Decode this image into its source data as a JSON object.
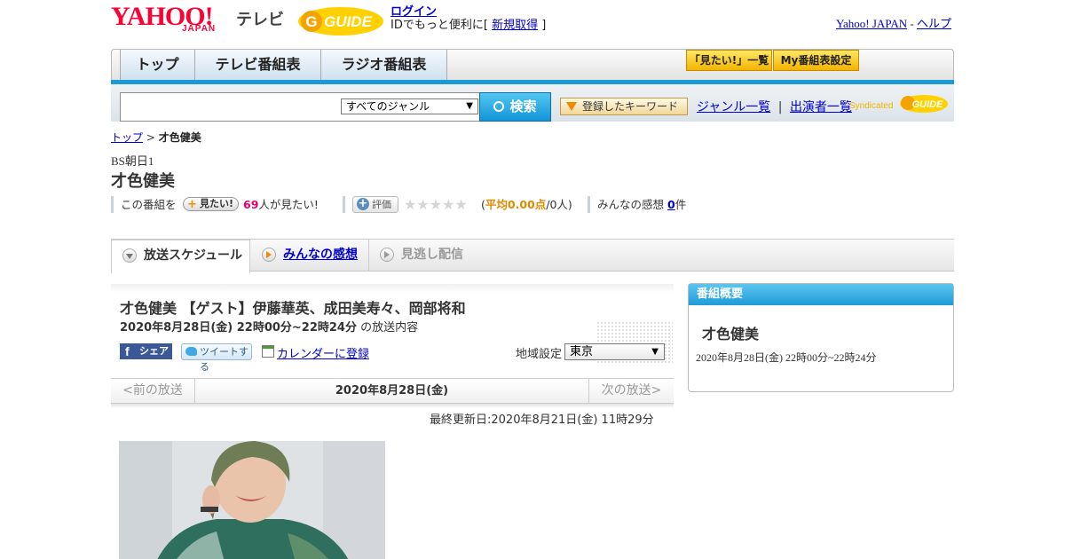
{
  "header": {
    "yahoo_logo": "YAHOO!",
    "japan_logo": "JAPAN",
    "tv_label": "テレビ",
    "gguide_logo": "G-GUIDE",
    "login_label": "ログイン",
    "login_sub_prefix": "IDでもっと便利に[ ",
    "signup_label": "新規取得",
    "login_sub_suffix": " ]",
    "yahoo_japan_link": "Yahoo! JAPAN",
    "separator": " - ",
    "help_link": "ヘルプ"
  },
  "nav": {
    "tabs": [
      {
        "label": "トップ"
      },
      {
        "label": "テレビ番組表"
      },
      {
        "label": "ラジオ番組表"
      }
    ],
    "mitai_list_button": "「見たい!」一覧",
    "my_schedule_button": "My番組表設定"
  },
  "search": {
    "input_value": "",
    "genre_selected": "すべてのジャンル",
    "search_button": "検索",
    "keyword_button": "登録したキーワード",
    "genre_list_link": "ジャンル一覧",
    "link_separator": "|",
    "performer_list_link": "出演者一覧",
    "syndicated_label": "Syndicated",
    "syndicated_logo": "GUIDE"
  },
  "breadcrumb": {
    "top": "トップ",
    "sep": " > ",
    "current": "才色健美"
  },
  "program": {
    "channel": "BS朝日1",
    "title": "才色健美",
    "mitai_prefix": "この番組を",
    "mitai_button": "見たい!",
    "mitai_count": "69",
    "mitai_suffix": "人が見たい!",
    "hyoka_button": "評価",
    "stars": "★★★★★",
    "rating_open": "(",
    "rating_avg_label": "平均0.00点",
    "rating_count": "/0人)",
    "kanso_label": "みんなの感想",
    "kanso_count": "0",
    "kanso_suffix": "件"
  },
  "tabs": [
    {
      "label": "放送スケジュール"
    },
    {
      "label": "みんなの感想"
    },
    {
      "label": "見逃し配信"
    }
  ],
  "episode": {
    "title": "才色健美 【ゲスト】伊藤華英、成田美寿々、岡部将和",
    "datetime": "2020年8月28日(金) 22時00分~22時24分",
    "datetime_suffix": " の放送内容",
    "share_button": "シェア",
    "share_icon": "f",
    "tweet_button": "ツイートする",
    "calendar_link": "カレンダーに登録",
    "region_label": "地域設定",
    "region_selected": "東京"
  },
  "pager": {
    "prev": "<前の放送",
    "current": "2020年8月28日(金)",
    "next": "次の放送>"
  },
  "updated": "最終更新日:2020年8月21日(金) 11時29分",
  "sidebar": {
    "heading": "番組概要",
    "title": "才色健美",
    "time": "2020年8月28日(金) 22時00分~22時24分"
  }
}
